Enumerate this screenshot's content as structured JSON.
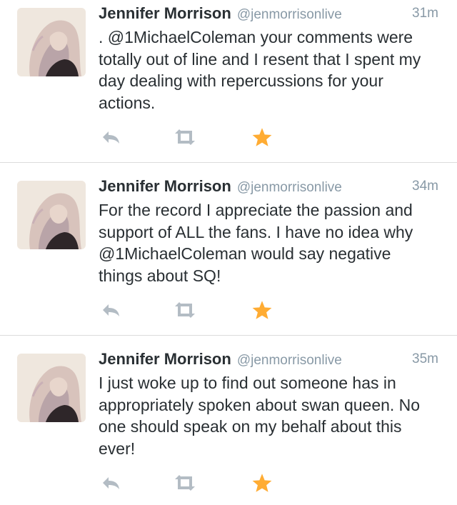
{
  "colors": {
    "name": "#292f33",
    "meta": "#8899a6",
    "icon_muted": "#b3bcc4",
    "favorite": "#ffac33",
    "divider": "#dcdcdc"
  },
  "icons": {
    "reply": "reply-arrow-icon",
    "retweet": "retweet-icon",
    "favorite": "star-icon"
  },
  "tweets": [
    {
      "author": "Jennifer Morrison",
      "handle": "@jenmorrisonlive",
      "time": "31m",
      "lines": [
        ". @1MichaelColeman your comments were",
        "totally out of line and I resent that I spent my",
        "day dealing with repercussions for your",
        "actions."
      ],
      "favorited": true
    },
    {
      "author": "Jennifer Morrison",
      "handle": "@jenmorrisonlive",
      "time": "34m",
      "lines": [
        "For the record I appreciate the passion and",
        "support of ALL the fans. I have no idea why",
        "@1MichaelColeman would say negative",
        "things about SQ!"
      ],
      "favorited": true
    },
    {
      "author": "Jennifer Morrison",
      "handle": "@jenmorrisonlive",
      "time": "35m",
      "lines": [
        "I just woke up to find out someone has in",
        "appropriately spoken about swan queen. No",
        "one should speak on my behalf about this",
        "ever!"
      ],
      "favorited": true
    }
  ]
}
